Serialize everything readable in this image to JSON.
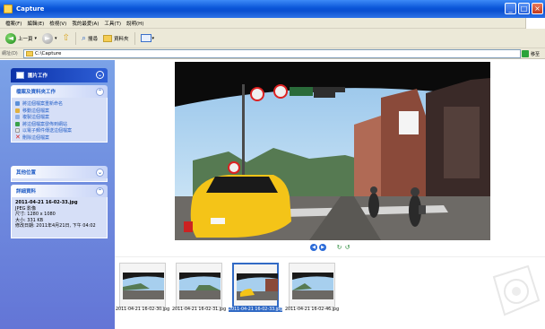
{
  "window": {
    "title": "Capture"
  },
  "menu": [
    "檔案(F)",
    "編輯(E)",
    "檢視(V)",
    "我的最愛(A)",
    "工具(T)",
    "說明(H)"
  ],
  "toolbar": {
    "back": "上一頁",
    "search": "搜尋",
    "folders": "資料夾"
  },
  "address": {
    "label": "網址(D)",
    "path": "C:\\Capture",
    "go": "移至"
  },
  "sidebar": {
    "picture_tasks": {
      "title": "圖片工作"
    },
    "file_tasks": {
      "title": "檔案及資料夾工作",
      "items": [
        "將這個檔案重新命名",
        "移動這個檔案",
        "複製這個檔案",
        "將這個檔案發佈到網站",
        "以電子郵件傳送這個檔案",
        "刪除這個檔案"
      ]
    },
    "other_places": {
      "title": "其他位置"
    },
    "details": {
      "title": "詳細資料",
      "name": "2011-04-21 16-02-33.jpg",
      "type": "JPEG 影像",
      "dims": "尺寸: 1280 x 1080",
      "size": "大小: 331 KB",
      "modified": "修改日期: 2011年4月21日, 下午 04:02"
    }
  },
  "filmstrip": [
    {
      "caption": "2011-04-21 16-02-30.jpg",
      "selected": false
    },
    {
      "caption": "2011-04-21 16-02-31.jpg",
      "selected": false
    },
    {
      "caption": "2011-04-21 16-02-33.jpg",
      "selected": true
    },
    {
      "caption": "2011-04-21 16-02-46.jpg",
      "selected": false
    }
  ],
  "colors": {
    "titlebar": "#0a55d8",
    "sidebar": "#6375d6",
    "selection": "#316ac5"
  }
}
